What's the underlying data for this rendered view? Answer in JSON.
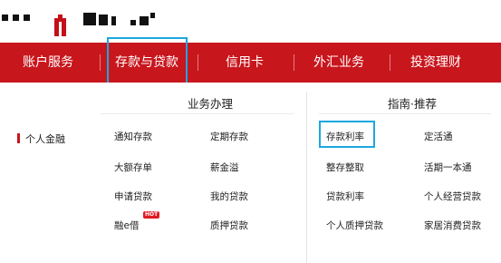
{
  "nav": {
    "items": [
      "账户服务",
      "存款与贷款",
      "信用卡",
      "外汇业务",
      "投资理财"
    ],
    "active_index": 1
  },
  "submenu": {
    "left_title": "业务办理",
    "right_title": "指南·推荐",
    "side_tag": "个人金融",
    "business_links": [
      [
        "通知存款",
        "定期存款"
      ],
      [
        "大额存单",
        "薪金溢"
      ],
      [
        "申请贷款",
        "我的贷款"
      ],
      [
        "融e借",
        "质押贷款"
      ]
    ],
    "guide_links": [
      [
        "存款利率",
        "定活通"
      ],
      [
        "整存整取",
        "活期一本通"
      ],
      [
        "贷款利率",
        "个人经营贷款"
      ],
      [
        "个人质押贷款",
        "家居消费贷款"
      ]
    ],
    "hot_badge": "HOT"
  },
  "colors": {
    "brand_red": "#c8161d",
    "highlight_blue": "#1ba7e0"
  }
}
